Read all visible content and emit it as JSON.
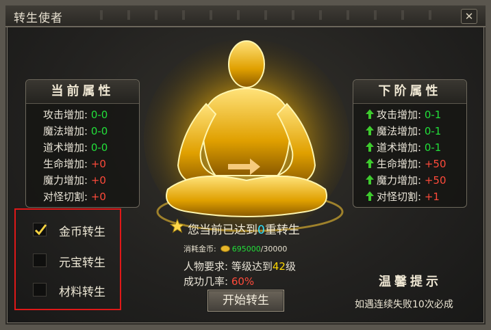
{
  "window": {
    "title": "转生使者"
  },
  "current_panel": {
    "header": "当前属性",
    "rows": [
      {
        "label": "攻击增加:",
        "value": "0-0"
      },
      {
        "label": "魔法增加:",
        "value": "0-0"
      },
      {
        "label": "道术增加:",
        "value": "0-0"
      },
      {
        "label": "生命增加:",
        "value": "+0"
      },
      {
        "label": "魔力增加:",
        "value": "+0"
      },
      {
        "label": "对怪切割:",
        "value": "+0"
      }
    ]
  },
  "next_panel": {
    "header": "下阶属性",
    "rows": [
      {
        "label": "攻击增加:",
        "value": "0-1"
      },
      {
        "label": "魔法增加:",
        "value": "0-1"
      },
      {
        "label": "道术增加:",
        "value": "0-1"
      },
      {
        "label": "生命增加:",
        "value": "+50"
      },
      {
        "label": "魔力增加:",
        "value": "+50"
      },
      {
        "label": "对怪切割:",
        "value": "+1"
      }
    ]
  },
  "options": [
    {
      "label": "金币转生",
      "checked": true
    },
    {
      "label": "元宝转生",
      "checked": false
    },
    {
      "label": "材料转生",
      "checked": false
    }
  ],
  "status": {
    "prefix": "您当前已达到",
    "count": "0",
    "suffix": "重转生"
  },
  "cost": {
    "label": "消耗金币:",
    "have": "695000",
    "need": "/30000"
  },
  "requirement": {
    "label": "人物要求:",
    "text_a": "等级达到",
    "level": "42",
    "text_b": "级"
  },
  "success": {
    "label": "成功几率:",
    "value": "60%"
  },
  "start_button": "开始转生",
  "tips": {
    "title": "温馨提示",
    "text": "如遇连续失败10次必成"
  },
  "colors": {
    "positive": "#22e03a",
    "negative": "#ff4a3a",
    "highlight": "#ffd700",
    "count": "#30e0ff",
    "selection_border": "#e01818"
  }
}
